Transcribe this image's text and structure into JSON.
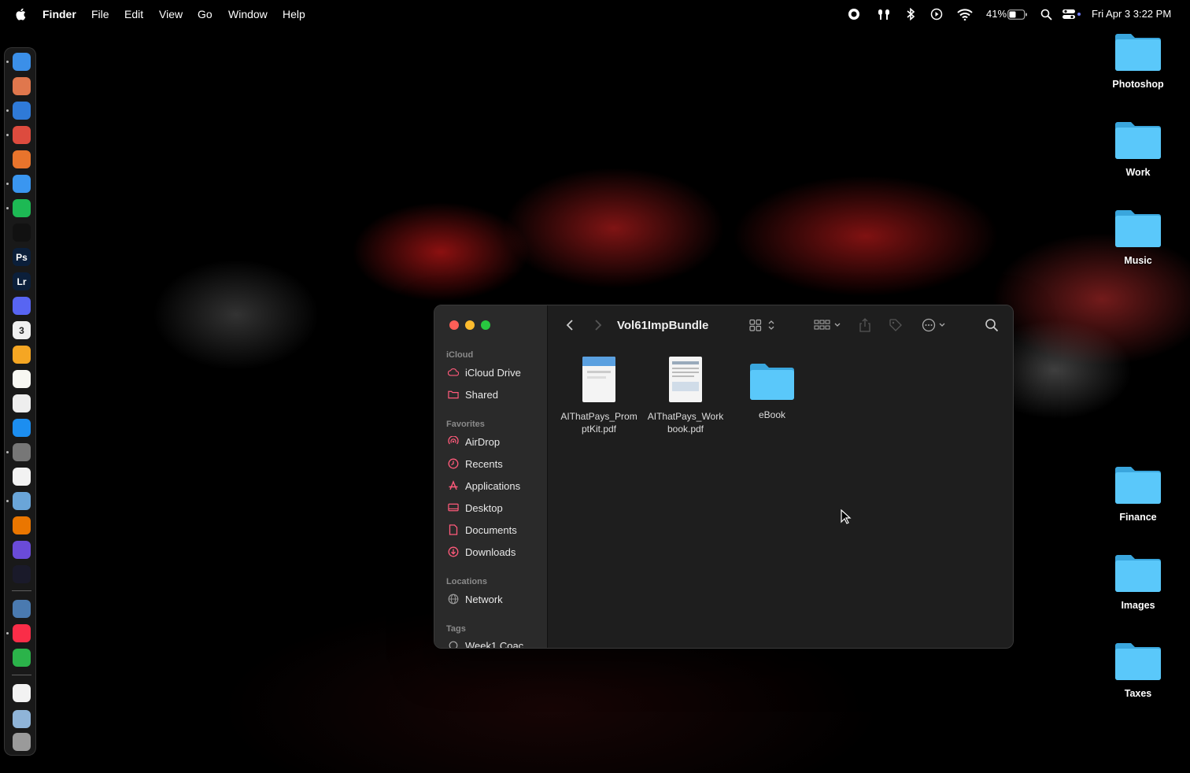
{
  "menubar": {
    "app_name": "Finder",
    "menus": [
      "File",
      "Edit",
      "View",
      "Go",
      "Window",
      "Help"
    ],
    "battery": "41%",
    "datetime": "Fri Apr 3  3:22 PM"
  },
  "desktop": {
    "folders": [
      "Photoshop",
      "Work",
      "Music",
      "Finance",
      "Images",
      "Taxes"
    ]
  },
  "dock": {
    "apps": [
      {
        "name": "finder",
        "glyph": "",
        "color": "#3b8fe8"
      },
      {
        "name": "launchpad",
        "glyph": "",
        "color": "#e0774d"
      },
      {
        "name": "safari",
        "glyph": "",
        "color": "#2f7ad8"
      },
      {
        "name": "chrome",
        "glyph": "",
        "color": "#dd4b3e"
      },
      {
        "name": "firefox",
        "glyph": "",
        "color": "#e8742c"
      },
      {
        "name": "mail",
        "glyph": "",
        "color": "#3a96f0"
      },
      {
        "name": "spotify",
        "glyph": "",
        "color": "#1db954"
      },
      {
        "name": "chatgpt",
        "glyph": "",
        "color": "#111111"
      },
      {
        "name": "photoshop",
        "glyph": "Ps",
        "color": "#0b1f3a"
      },
      {
        "name": "lightroom",
        "glyph": "Lr",
        "color": "#0b1f3a"
      },
      {
        "name": "discord",
        "glyph": "",
        "color": "#5865f2"
      },
      {
        "name": "calendar",
        "glyph": "3",
        "color": "#f0f0f0"
      },
      {
        "name": "pages",
        "glyph": "",
        "color": "#f5a623"
      },
      {
        "name": "notes",
        "glyph": "",
        "color": "#f7f7f2"
      },
      {
        "name": "notion",
        "glyph": "",
        "color": "#eeeeee"
      },
      {
        "name": "app-store",
        "glyph": "",
        "color": "#1c8ef0"
      },
      {
        "name": "system-settings",
        "glyph": "",
        "color": "#777777"
      },
      {
        "name": "textedit",
        "glyph": "",
        "color": "#f2f2f2"
      },
      {
        "name": "preview",
        "glyph": "",
        "color": "#6aa5d8"
      },
      {
        "name": "blender",
        "glyph": "",
        "color": "#ea7600"
      },
      {
        "name": "imovie",
        "glyph": "",
        "color": "#6a4bd8"
      },
      {
        "name": "clock",
        "glyph": "",
        "color": "#1a1a2a"
      },
      {
        "name": "screen-sharing",
        "glyph": "",
        "color": "#4a7ab0"
      },
      {
        "name": "music",
        "glyph": "",
        "color": "#fa2d48"
      },
      {
        "name": "numbers",
        "glyph": "",
        "color": "#2bb34a"
      },
      {
        "name": "document",
        "glyph": "",
        "color": "#f2f2f2"
      },
      {
        "name": "downloads-stack",
        "glyph": "",
        "color": "#8fb4d8"
      },
      {
        "name": "trash",
        "glyph": "",
        "color": "#9a9a9a"
      }
    ]
  },
  "finder": {
    "title": "Vol61ImpBundle",
    "sidebar": {
      "icloud_header": "iCloud",
      "icloud_items": [
        "iCloud Drive",
        "Shared"
      ],
      "favorites_header": "Favorites",
      "favorites_items": [
        "AirDrop",
        "Recents",
        "Applications",
        "Desktop",
        "Documents",
        "Downloads"
      ],
      "locations_header": "Locations",
      "locations_items": [
        "Network"
      ],
      "tags_header": "Tags",
      "tags_items": [
        "Week1 Coac"
      ]
    },
    "files": [
      {
        "line1": "AIThatPays_Prom",
        "line2": "ptKit.pdf",
        "type": "pdf"
      },
      {
        "line1": "AIThatPays_Work",
        "line2": "book.pdf",
        "type": "pdf"
      },
      {
        "line1": "eBook",
        "line2": "",
        "type": "folder"
      }
    ]
  },
  "colors": {
    "folder_blue": "#5ac8fa",
    "accent_pink": "#ff5a7a",
    "close": "#ff5f57",
    "minimize": "#febc2e",
    "zoom": "#28c840"
  }
}
